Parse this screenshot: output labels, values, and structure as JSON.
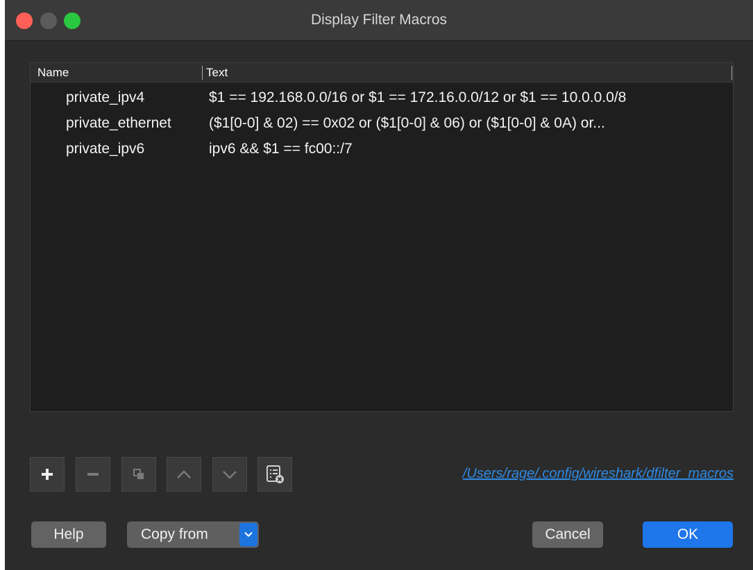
{
  "window": {
    "title": "Display Filter Macros"
  },
  "table": {
    "columns": [
      "Name",
      "Text"
    ],
    "rows": [
      {
        "name": "private_ipv4",
        "text": "$1 == 192.168.0.0/16 or $1 == 172.16.0.0/12 or $1 == 10.0.0.0/8"
      },
      {
        "name": "private_ethernet",
        "text": "($1[0-0] & 02) == 0x02 or ($1[0-0] & 06) or ($1[0-0] & 0A) or..."
      },
      {
        "name": "private_ipv6",
        "text": "ipv6 && $1 == fc00::/7"
      }
    ]
  },
  "toolbar": {
    "buttons": [
      "add-icon",
      "remove-icon",
      "copy-icon",
      "move-up-icon",
      "move-down-icon",
      "clear-icon"
    ]
  },
  "file_path": "/Users/rage/.config/wireshark/dfilter_macros",
  "buttons": {
    "help": "Help",
    "copy_from": "Copy from",
    "cancel": "Cancel",
    "ok": "OK"
  },
  "colors": {
    "close": "#fe5f57",
    "minimize": "#5b5b5b",
    "zoom": "#2ac840",
    "accent": "#1f75ea",
    "link": "#2e89e3"
  }
}
